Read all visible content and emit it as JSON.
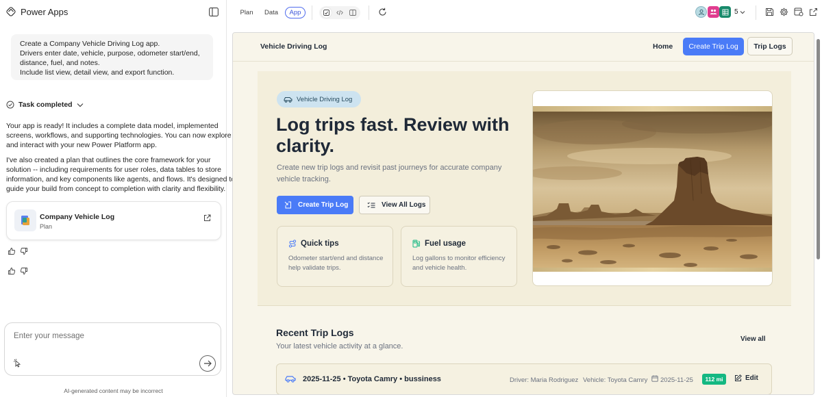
{
  "app": {
    "name": "Power Apps"
  },
  "chat": {
    "prompt_lines": [
      "Create a Company Vehicle Driving Log app.",
      "Drivers enter date, vehicle, purpose, odometer start/end,",
      "distance, fuel, and notes.",
      "Include list view, detail view, and export function."
    ],
    "task_status": "Task completed",
    "response1_lines": [
      "Your app is ready! It includes a complete data model, implemented",
      "screens, workflows, and supporting technologies. You can now explore",
      "and interact with your new Power Platform app."
    ],
    "response2_lines": [
      "I've also created a plan that outlines the core framework for your",
      "solution -- including requirements for user roles, data tables to store",
      "information, and key components like agents, and flows. It's designed to",
      "guide your build from concept to completion with clarity and flexibility."
    ],
    "plan_card": {
      "title": "Company Vehicle Log",
      "subtitle": "Plan"
    },
    "input_placeholder": "Enter your message",
    "disclaimer": "AI-generated content may be incorrect"
  },
  "topbar": {
    "tabs": [
      "Plan",
      "Data",
      "App"
    ],
    "active_tab": "App",
    "collaborator_count": "5"
  },
  "preview": {
    "nav": {
      "title": "Vehicle Driving Log",
      "home": "Home",
      "create": "Create Trip Log",
      "logs": "Trip Logs"
    },
    "hero": {
      "badge": "Vehicle Driving Log",
      "title": "Log trips fast. Review with clarity.",
      "subtitle": "Create new trip logs and revisit past journeys for accurate company vehicle tracking.",
      "primary_button": "Create Trip Log",
      "secondary_button": "View All Logs",
      "cards": [
        {
          "title": "Quick tips",
          "text": "Odometer start/end and distance help validate trips."
        },
        {
          "title": "Fuel usage",
          "text": "Log gallons to monitor efficiency and vehicle health."
        }
      ]
    },
    "recent": {
      "title": "Recent Trip Logs",
      "subtitle": "Your latest vehicle activity at a glance.",
      "view_all": "View all",
      "rows": [
        {
          "title": "2025-11-25 • Toyota Camry • bussiness",
          "driver": "Driver: Maria Rodriguez",
          "vehicle": "Vehicle: Toyota Camry",
          "date": "2025-11-25",
          "miles": "112 mi",
          "edit": "Edit"
        }
      ]
    }
  },
  "colors": {
    "accent": "#4a7bf7",
    "hero_bg": "#f3eedb",
    "page_bg": "#f8f5ea",
    "badge_bg": "#cde3f0",
    "miles_badge": "#14b882"
  }
}
